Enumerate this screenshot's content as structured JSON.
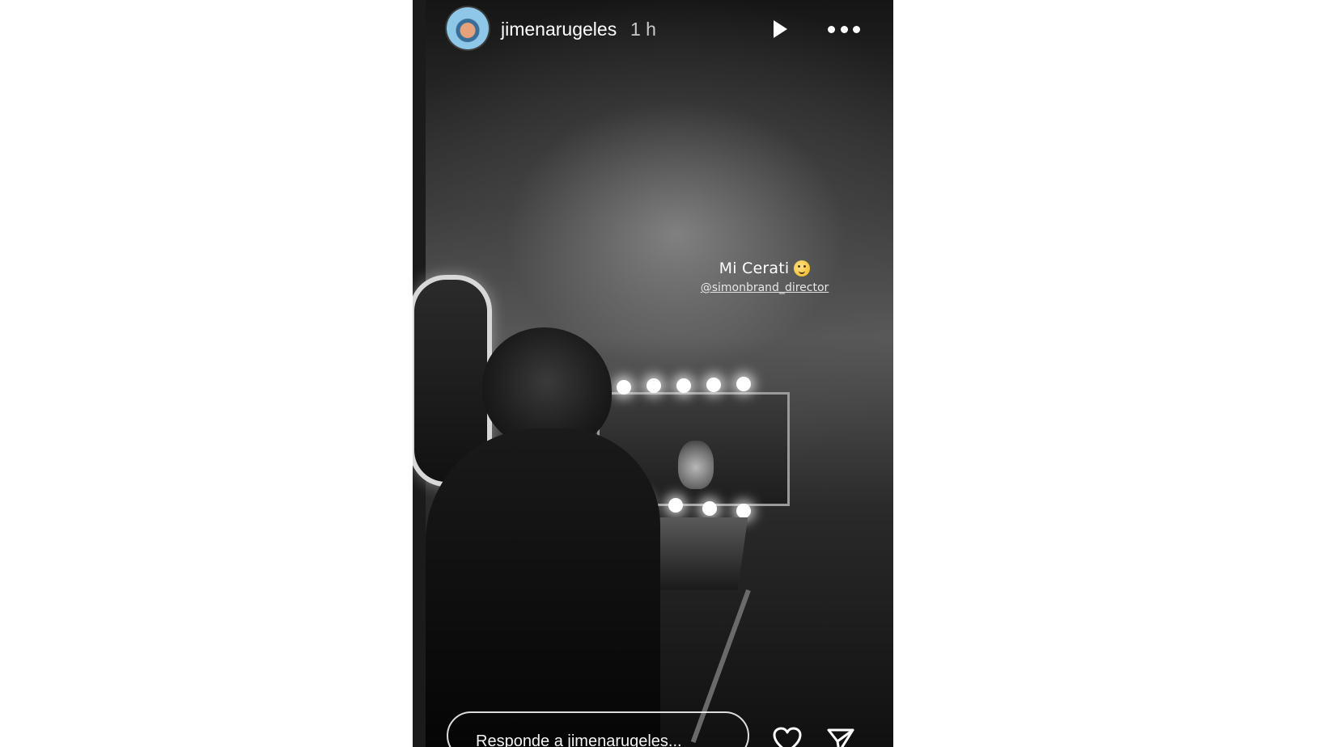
{
  "header": {
    "username": "jimenarugeles",
    "time": "1 h",
    "avatar": "avatar",
    "icons": {
      "play": "play-icon",
      "more": "more-icon"
    }
  },
  "story": {
    "caption": "Mi Cerati",
    "mention": "@simonbrand_director",
    "emoji": "smiling-face-emoji"
  },
  "footer": {
    "reply_placeholder": "Responde a jimenarugeles...",
    "icons": {
      "like": "heart-icon",
      "share": "send-icon"
    }
  },
  "colors": {
    "page_background": "#ffffff",
    "story_background": "#0b0b0b",
    "text": "#ffffff",
    "secondary_text": "#c9c9c9"
  }
}
